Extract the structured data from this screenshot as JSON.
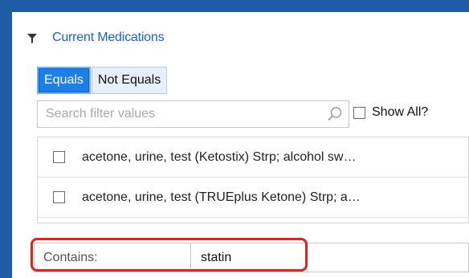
{
  "filter": {
    "title": "Current Medications",
    "icon": "funnel-icon"
  },
  "mode_toggle": {
    "equals_label": "Equals",
    "not_equals_label": "Not Equals",
    "selected": "Equals"
  },
  "search": {
    "placeholder": "Search filter values",
    "value": "",
    "icon": "search-icon"
  },
  "show_all": {
    "label": "Show All?",
    "checked": false
  },
  "values_list": [
    {
      "label": "acetone, urine, test (Ketostix) Strp; alcohol sw…",
      "checked": false
    },
    {
      "label": "acetone, urine, test (TRUEplus Ketone) Strp; a…",
      "checked": false
    }
  ],
  "contains": {
    "label": "Contains:",
    "value": "statin"
  },
  "colors": {
    "frame_blue": "#1f5ca6",
    "link_blue": "#1a5fd1",
    "active_toggle": "#1e7ee8",
    "highlight_red": "#e0241b"
  }
}
